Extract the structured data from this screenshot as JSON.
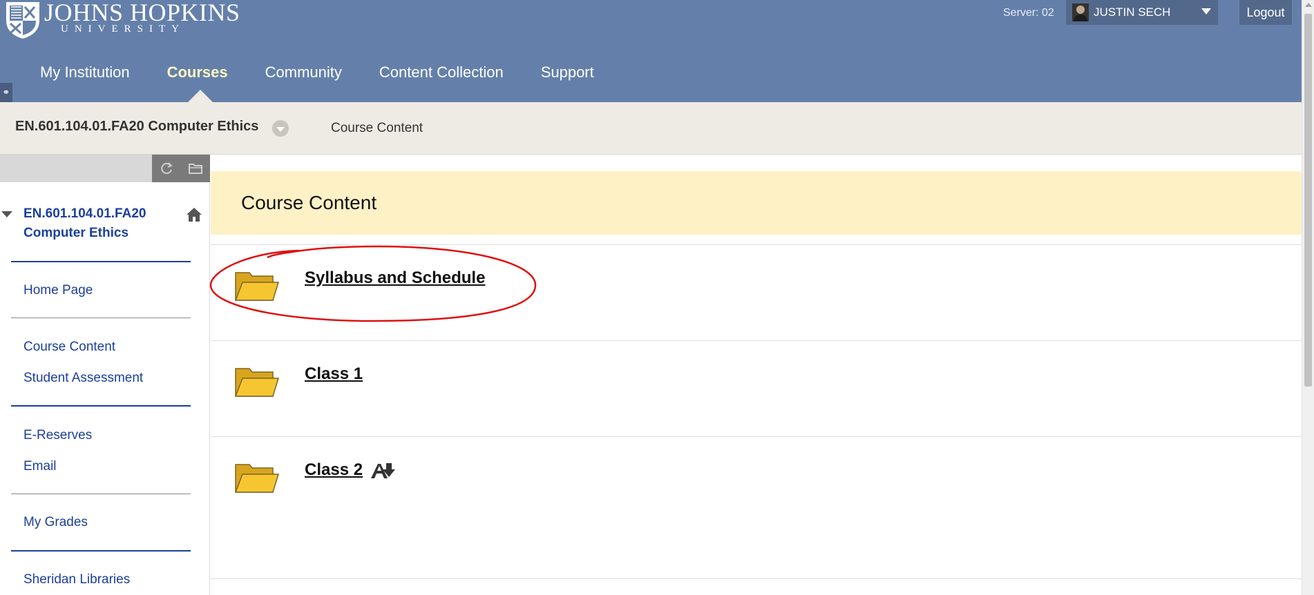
{
  "header": {
    "logo_name": "JOHNS HOPKINS",
    "logo_sub": "UNIVERSITY",
    "server_label": "Server: 02",
    "user_name": "JUSTIN SECH",
    "logout_label": "Logout",
    "nav": [
      {
        "label": "My Institution",
        "active": false
      },
      {
        "label": "Courses",
        "active": true
      },
      {
        "label": "Community",
        "active": false
      },
      {
        "label": "Content Collection",
        "active": false
      },
      {
        "label": "Support",
        "active": false
      }
    ]
  },
  "breadcrumb": {
    "course": "EN.601.104.01.FA20 Computer Ethics",
    "page": "Course Content"
  },
  "sidebar": {
    "course_title": "EN.601.104.01.FA20 Computer Ethics",
    "groups": [
      [
        "Home Page"
      ],
      [
        "Course Content",
        "Student Assessment"
      ],
      [
        "E-Reserves",
        "Email"
      ],
      [
        "My Grades"
      ],
      [
        "Sheridan Libraries"
      ]
    ]
  },
  "content": {
    "title": "Course Content",
    "items": [
      {
        "title": "Syllabus and Schedule",
        "icon": "folder-icon",
        "highlighted": true,
        "badge": null
      },
      {
        "title": "Class 1",
        "icon": "folder-icon",
        "highlighted": false,
        "badge": null
      },
      {
        "title": "Class 2",
        "icon": "folder-icon",
        "highlighted": false,
        "badge": "accessibility-download-icon"
      }
    ]
  },
  "colors": {
    "header_bg": "#6480aa",
    "nav_active": "#fff8c0",
    "crumbbar_bg": "#eeebe4",
    "title_bar_bg": "#fff1c6",
    "link_blue": "#1b3f9c",
    "highlight_red": "#e01010"
  }
}
